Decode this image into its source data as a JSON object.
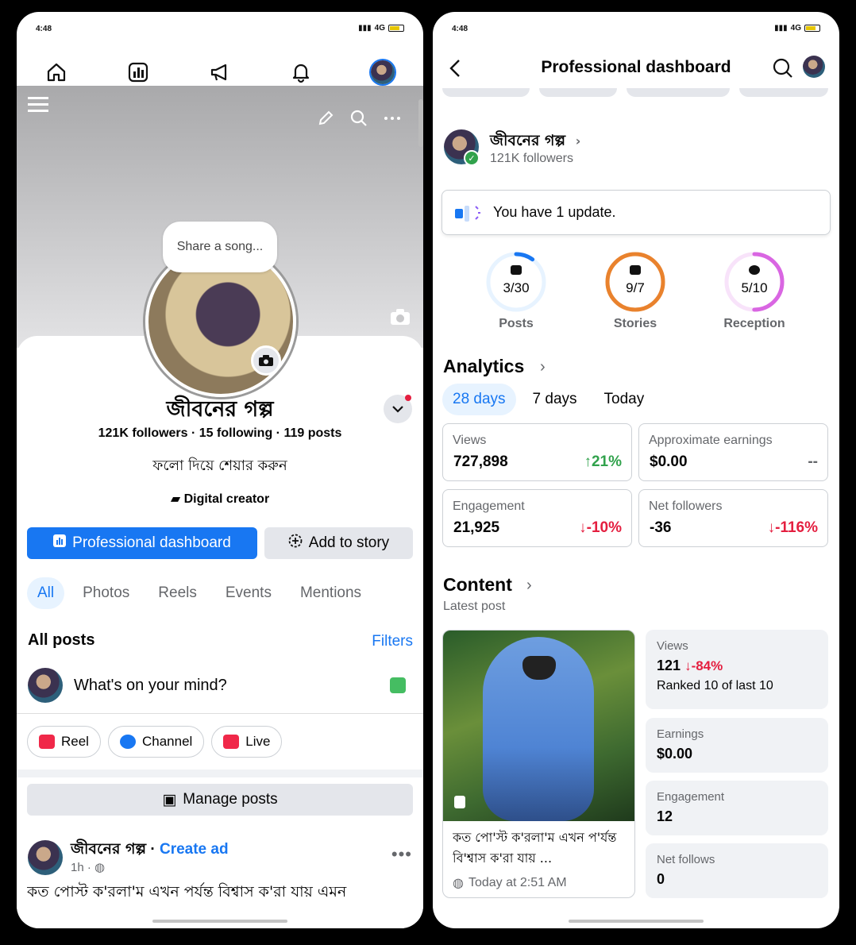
{
  "left": {
    "status": {
      "time": "4:48",
      "net": "4G",
      "battery": "58"
    },
    "cover": {
      "song_prompt": "Share a song..."
    },
    "profile": {
      "name": "জীবনের গল্প",
      "stats": "121K followers · 15 following · 119 posts",
      "bio": "ফলো দিয়ে শেয়ার করুন",
      "category": "Digital creator"
    },
    "buttons": {
      "dashboard": "Professional dashboard",
      "story": "Add to story"
    },
    "tabs": [
      "All",
      "Photos",
      "Reels",
      "Events",
      "Mentions"
    ],
    "section": {
      "title": "All posts",
      "filters": "Filters"
    },
    "composer": {
      "placeholder": "What's on your mind?"
    },
    "chips": [
      "Reel",
      "Channel",
      "Live"
    ],
    "manage": "Manage posts",
    "post": {
      "author": "জীবনের গল্প",
      "separator": " · ",
      "create_ad": "Create ad",
      "time": "1h ·",
      "text": "কত পোস্ট ক'রলা'ম এখন পর্যন্ত বিশ্বাস ক'রা যায় এমন"
    }
  },
  "right": {
    "status": {
      "time": "4:48",
      "net": "4G",
      "battery": "58"
    },
    "header": {
      "title": "Professional dashboard"
    },
    "page": {
      "name": "জীবনের গল্প",
      "followers": "121K followers"
    },
    "update": "You have 1 update.",
    "rings": [
      {
        "value": "3/30",
        "label": "Posts",
        "progress": 0.1,
        "color": "#1877f2",
        "track": "#e7f3ff"
      },
      {
        "value": "9/7",
        "label": "Stories",
        "progress": 1,
        "color": "#e9822d",
        "track": "#fde8d3"
      },
      {
        "value": "5/10",
        "label": "Reception",
        "progress": 0.5,
        "color": "#d966e2",
        "track": "#f8e3fa"
      }
    ],
    "analytics": {
      "title": "Analytics",
      "tabs": [
        "28 days",
        "7 days",
        "Today"
      ],
      "metrics": [
        {
          "label": "Views",
          "value": "727,898",
          "change": "↑21%",
          "trend": "up"
        },
        {
          "label": "Approximate earnings",
          "value": "$0.00",
          "change": "--",
          "trend": "neutral"
        },
        {
          "label": "Engagement",
          "value": "21,925",
          "change": "↓-10%",
          "trend": "down"
        },
        {
          "label": "Net followers",
          "value": "-36",
          "change": "↓-116%",
          "trend": "down"
        }
      ]
    },
    "content": {
      "title": "Content",
      "subtitle": "Latest post",
      "caption": "কত পো'স্ট ক'রলা'ম এখন প'র্যন্ত বি'শ্বাস ক'রা যায় ...",
      "time": "Today at 2:51 AM",
      "cards": {
        "views_label": "Views",
        "views_value": "121",
        "views_change": "↓-84%",
        "views_rank": "Ranked 10 of last 10",
        "earnings_label": "Earnings",
        "earnings_value": "$0.00",
        "engagement_label": "Engagement",
        "engagement_value": "12",
        "follows_label": "Net follows",
        "follows_value": "0"
      }
    }
  }
}
